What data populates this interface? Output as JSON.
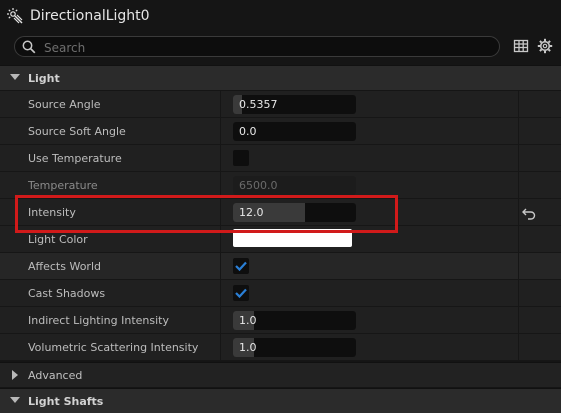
{
  "header": {
    "title": "DirectionalLight0",
    "icon": "directional-light-icon"
  },
  "search": {
    "placeholder": "Search",
    "value": ""
  },
  "toolbar": {
    "icons": [
      "table-view-icon",
      "settings-gear-icon"
    ]
  },
  "categories": [
    {
      "label": "Light",
      "expanded": true
    },
    {
      "label": "Advanced",
      "expanded": false
    },
    {
      "label": "Light Shafts",
      "expanded": true
    }
  ],
  "properties": [
    {
      "name": "Source Angle",
      "type": "number",
      "value": "0.5357",
      "slider_fraction": 0.07
    },
    {
      "name": "Source Soft Angle",
      "type": "number",
      "value": "0.0",
      "slider_fraction": 0
    },
    {
      "name": "Use Temperature",
      "type": "checkbox",
      "checked": false
    },
    {
      "name": "Temperature",
      "type": "number",
      "value": "6500.0",
      "disabled": true
    },
    {
      "name": "Intensity",
      "type": "number",
      "value": "12.0",
      "slider_fraction": 0.58,
      "modified": true,
      "highlighted": true
    },
    {
      "name": "Light Color",
      "type": "color",
      "value": "#ffffff"
    },
    {
      "name": "Affects World",
      "type": "checkbox",
      "checked": true
    },
    {
      "name": "Cast Shadows",
      "type": "checkbox",
      "checked": true
    },
    {
      "name": "Indirect Lighting Intensity",
      "type": "number",
      "value": "1.0",
      "slider_fraction": 0.17
    },
    {
      "name": "Volumetric Scattering Intensity",
      "type": "number",
      "value": "1.0",
      "slider_fraction": 0.17
    }
  ],
  "colors": {
    "accent_check": "#2a7fd6",
    "highlight_box": "#d11a1a"
  }
}
